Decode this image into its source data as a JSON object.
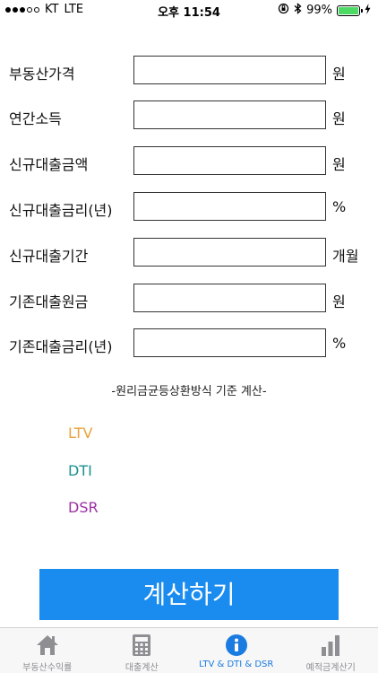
{
  "status_bar": {
    "carrier": "KT",
    "network": "LTE",
    "time": "오후 11:54",
    "battery_percent": "99%",
    "battery_level": 0.99
  },
  "form": {
    "fields": [
      {
        "label": "부동산가격",
        "unit": "원",
        "value": ""
      },
      {
        "label": "연간소득",
        "unit": "원",
        "value": ""
      },
      {
        "label": "신규대출금액",
        "unit": "원",
        "value": ""
      },
      {
        "label": "신규대출금리(년)",
        "unit": "%",
        "value": ""
      },
      {
        "label": "신규대출기간",
        "unit": "개월",
        "value": ""
      },
      {
        "label": "기존대출원금",
        "unit": "원",
        "value": ""
      },
      {
        "label": "기존대출금리(년)",
        "unit": "%",
        "value": ""
      }
    ],
    "method_note": "-원리금균등상환방식 기준 계산-"
  },
  "results": {
    "ltv_label": "LTV",
    "dti_label": "DTI",
    "dsr_label": "DSR"
  },
  "colors": {
    "ltv": "#e8a33a",
    "dti": "#1a8f8f",
    "dsr": "#9b2fa3",
    "button": "#1a8cf0",
    "tab_active": "#1a7be0",
    "tab_inactive": "#8e8e93"
  },
  "calc_button_label": "계산하기",
  "tab_bar": {
    "tabs": [
      {
        "label": "부동산수익률",
        "icon": "home-icon",
        "active": false
      },
      {
        "label": "대출계산",
        "icon": "calculator-icon",
        "active": false
      },
      {
        "label": "LTV & DTI & DSR",
        "icon": "info-icon",
        "active": true
      },
      {
        "label": "예적금계산기",
        "icon": "bar-chart-icon",
        "active": false
      }
    ]
  }
}
